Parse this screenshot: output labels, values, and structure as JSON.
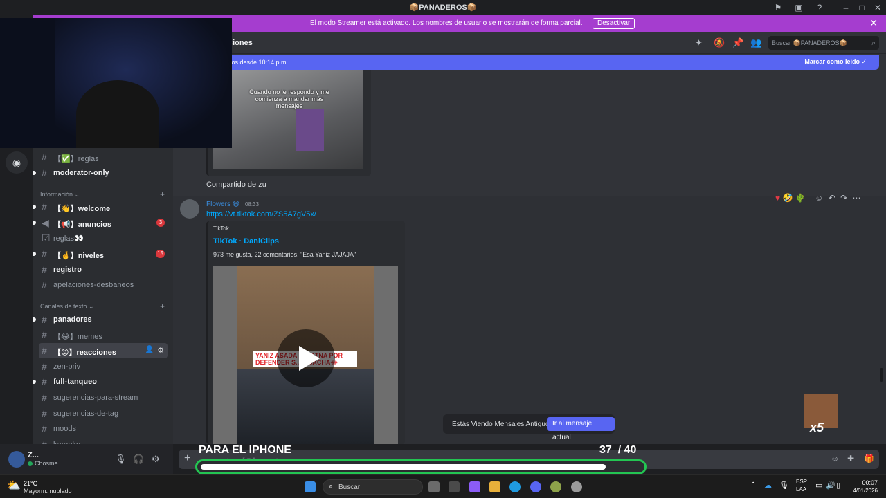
{
  "window": {
    "title": "📦PANADEROS📦"
  },
  "streamer_banner": {
    "message": "El modo Streamer está activado. Los nombres de usuario se mostrarán de forma parcial.",
    "button": "Desactivar"
  },
  "header": {
    "channel_title": "ciones",
    "search_placeholder": "Buscar 📦PANADEROS📦"
  },
  "new_messages": {
    "text": "vos desde 10:14 p.m.",
    "mark_read": "Marcar como leído"
  },
  "sidebar": {
    "channels_top": [
      {
        "name": "【✅】reglas",
        "unread": false
      },
      {
        "name": "moderator-only",
        "unread": true
      }
    ],
    "category_info": "Información",
    "info_channels": [
      {
        "name": "【👋】welcome",
        "unread": true,
        "badge": ""
      },
      {
        "name": "【📢】anuncios",
        "unread": true,
        "badge": "3"
      },
      {
        "name": "reglas👀",
        "unread": false,
        "badge": ""
      },
      {
        "name": "【🤞】niveles",
        "unread": true,
        "badge": "15"
      },
      {
        "name": "registro",
        "unread": true,
        "badge": ""
      },
      {
        "name": "apelaciones-desbaneos",
        "unread": false,
        "badge": ""
      }
    ],
    "category_text": "Canales de texto",
    "text_channels": [
      {
        "name": "panadores",
        "unread": true
      },
      {
        "name": "【😂】memes",
        "unread": false
      },
      {
        "name": "【😡】reacciones",
        "unread": true,
        "selected": true
      },
      {
        "name": "zen-priv",
        "unread": false
      },
      {
        "name": "full-tanqueo",
        "unread": true
      },
      {
        "name": "sugerencias-para-stream",
        "unread": false
      },
      {
        "name": "sugerencias-de-tag",
        "unread": false
      },
      {
        "name": "moods",
        "unread": false
      },
      {
        "name": "karaoke",
        "unread": false
      }
    ]
  },
  "user": {
    "name": "Z...",
    "status": "Chosme"
  },
  "chat": {
    "prev_video_caption": "Cuando no le respondo y me comienza a mandar más mensajes",
    "prev_message": "Compartido de zu",
    "message": {
      "author": "Flowers",
      "time": "08:33",
      "link": "https://vt.tiktok.com/ZS5A7gV5x/",
      "embed_provider": "TikTok",
      "embed_title": "TikTok · DaniClips",
      "embed_desc": "973 me gusta, 22 comentarios. \"Esa Yaniz JAJAJA\"",
      "thumb_text": "YANIZ ASADA ... MATNA POR DEFENDER S... A SACHA😂"
    },
    "composer_placeholder": "Mensaje #【😡】reacciones"
  },
  "old_messages": {
    "text": "Estás Viendo Mensajes Antiguos",
    "button": "Ir al mensaje actual"
  },
  "overlay": {
    "title": "PARA EL IPHONE",
    "current": "37",
    "total": "/ 40",
    "progress": 0.92,
    "multiplier": "x5"
  },
  "taskbar": {
    "weather_temp": "21°C",
    "weather_desc": "Mayorm. nublado",
    "search": "Buscar",
    "lang": "ESP",
    "lang2": "LAA",
    "time": "00:07",
    "date": "4/01/2026"
  },
  "colors": {
    "streamer": "#a53dcf",
    "accent": "#5865f2",
    "progress_border": "#23c552"
  }
}
